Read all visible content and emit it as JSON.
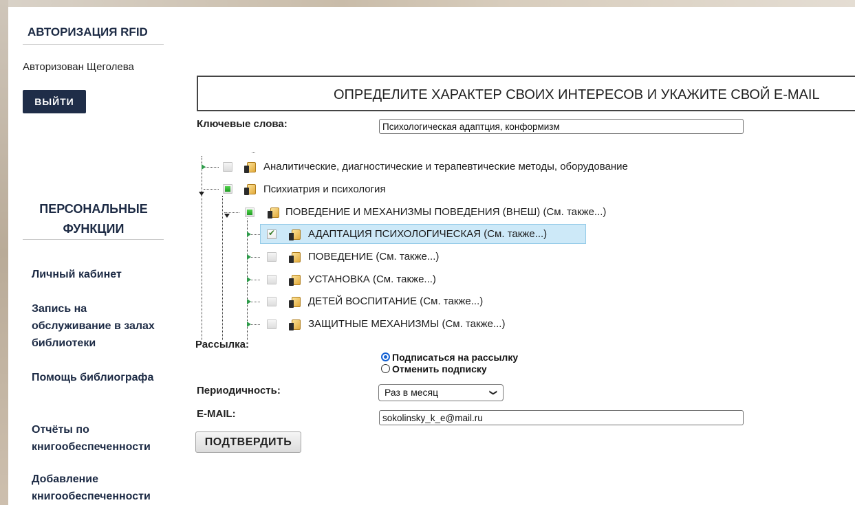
{
  "sidebar": {
    "auth_title": "АВТОРИЗАЦИЯ RFID",
    "authorized_user": "Авторизован Щеголева",
    "logout_label": "ВЫЙТИ",
    "personal_title": "ПЕРСОНАЛЬНЫЕ ФУНКЦИИ",
    "menu": [
      "Личный кабинет",
      "Запись на обслуживание в залах библиотеки",
      "Помощь библиографа",
      "Отчёты по книгообеспеченности",
      "Добавление книгообеспеченности"
    ]
  },
  "main": {
    "header": "ОПРЕДЕЛИТЕ ХАРАКТЕР СВОИХ ИНТЕРЕСОВ И УКАЖИТЕ СВОЙ E-MAIL",
    "keywords_label": "Ключевые слова:",
    "keywords_value": "Психологическая адаптция, конформизм",
    "tree": [
      {
        "label": "Аналитические, диагностические и терапевтические методы, оборудование",
        "state": "unchecked",
        "level": 0
      },
      {
        "label": "Психиатрия и психология",
        "state": "partial",
        "level": 0
      },
      {
        "label": "ПОВЕДЕНИЕ И МЕХАНИЗМЫ ПОВЕДЕНИЯ (ВНЕШ) (См. также...)",
        "state": "partial",
        "level": 1
      },
      {
        "label": "АДАПТАЦИЯ ПСИХОЛОГИЧЕСКАЯ (См. также...)",
        "state": "checked",
        "level": 2,
        "selected": true
      },
      {
        "label": "ПОВЕДЕНИЕ (См. также...)",
        "state": "unchecked",
        "level": 2
      },
      {
        "label": "УСТАНОВКА (См. также...)",
        "state": "unchecked",
        "level": 2
      },
      {
        "label": "ДЕТЕЙ ВОСПИТАНИЕ (См. также...)",
        "state": "unchecked",
        "level": 2
      },
      {
        "label": "ЗАЩИТНЫЕ МЕХАНИЗМЫ (См. также...)",
        "state": "unchecked",
        "level": 2
      }
    ],
    "mailing_label": "Рассылка:",
    "subscribe_option": "Подписаться на рассылку",
    "unsubscribe_option": "Отменить подписку",
    "subscription_selected": "subscribe",
    "period_label": "Периодичность:",
    "period_value": "Раз в месяц",
    "email_label": "E-MAIL:",
    "email_value": "sokolinsky_k_e@mail.ru",
    "confirm_label": "ПОДТВЕРДИТЬ"
  },
  "colors": {
    "nav_text": "#1c2a44",
    "logout_bg": "#1f2d48",
    "selection_bg": "#cde9f8",
    "partial_check": "#2eb32e",
    "radio_accent": "#1663d4"
  }
}
